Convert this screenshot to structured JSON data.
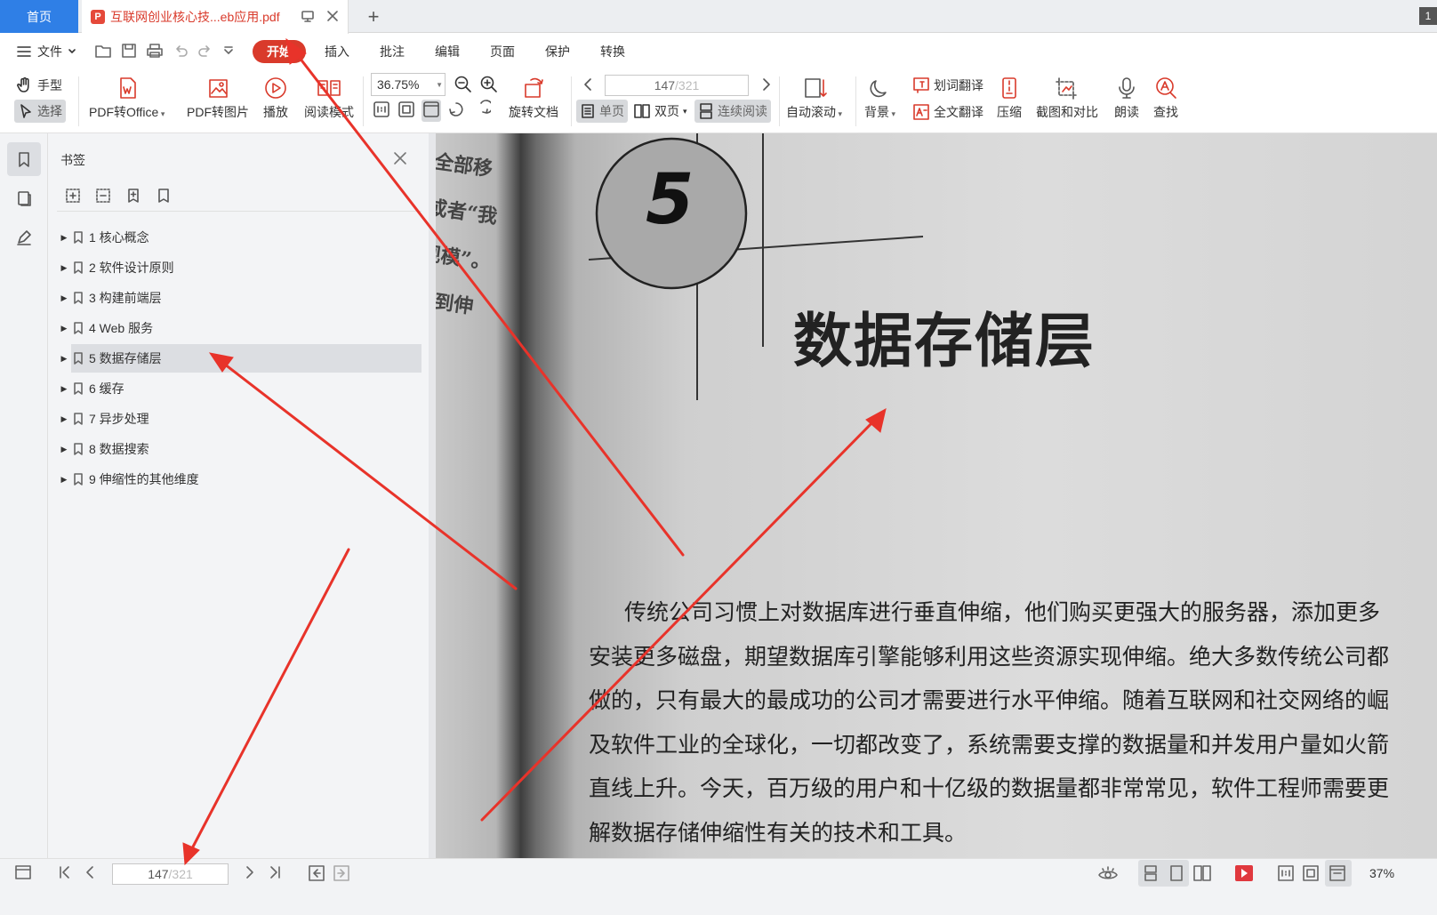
{
  "tabs": {
    "home": "首页",
    "doc": "互联网创业核心技...eb应用.pdf",
    "doc_icon": "P",
    "badge": "1"
  },
  "menu": {
    "file": "文件",
    "items": [
      "开始",
      "插入",
      "批注",
      "编辑",
      "页面",
      "保护",
      "转换"
    ],
    "active_index": 0
  },
  "ribbon": {
    "hand": "手型",
    "select": "选择",
    "pdf_to_office": "PDF转Office",
    "pdf_to_image": "PDF转图片",
    "play": "播放",
    "read_mode": "阅读模式",
    "zoom": "36.75%",
    "rotate_doc": "旋转文档",
    "page_current": "147",
    "page_total": "/321",
    "single": "单页",
    "double": "双页",
    "continuous": "连续阅读",
    "auto_scroll": "自动滚动",
    "background": "背景",
    "word_translate": "划词翻译",
    "full_translate": "全文翻译",
    "compress": "压缩",
    "screenshot_compare": "截图和对比",
    "read_aloud": "朗读",
    "find": "查找"
  },
  "bookmarks": {
    "title": "书签",
    "items": [
      {
        "label": "1 核心概念"
      },
      {
        "label": "2 软件设计原则"
      },
      {
        "label": "3 构建前端层"
      },
      {
        "label": "4 Web 服务"
      },
      {
        "label": "5 数据存储层",
        "selected": true
      },
      {
        "label": "6 缓存"
      },
      {
        "label": "7 异步处理"
      },
      {
        "label": "8 数据搜索"
      },
      {
        "label": "9 伸缩性的其他维度"
      }
    ]
  },
  "document": {
    "chapter_number": "5",
    "chapter_title": "数据存储层",
    "left_page_fragments": [
      "全部移",
      "或者“我",
      "规模”。",
      "及到伸"
    ],
    "body": [
      "传统公司习惯上对数据库进行垂直伸缩，他们购买更强大的服务器，添加更多",
      "安装更多磁盘，期望数据库引擎能够利用这些资源实现伸缩。绝大多数传统公司都",
      "做的，只有最大的最成功的公司才需要进行水平伸缩。随着互联网和社交网络的崛",
      "及软件工业的全球化，一切都改变了，系统需要支撑的数据量和并发用户量如火箭",
      "直线上升。今天，百万级的用户和十亿级的数据量都非常常见，软件工程师需要更",
      "解数据存储伸缩性有关的技术和工具。"
    ]
  },
  "statusbar": {
    "page_current": "147",
    "page_total": "/321",
    "zoom": "37%"
  },
  "colors": {
    "accent_blue": "#2f7fe6",
    "brand_red": "#d93a2b",
    "arrow_red": "#e8332a"
  }
}
